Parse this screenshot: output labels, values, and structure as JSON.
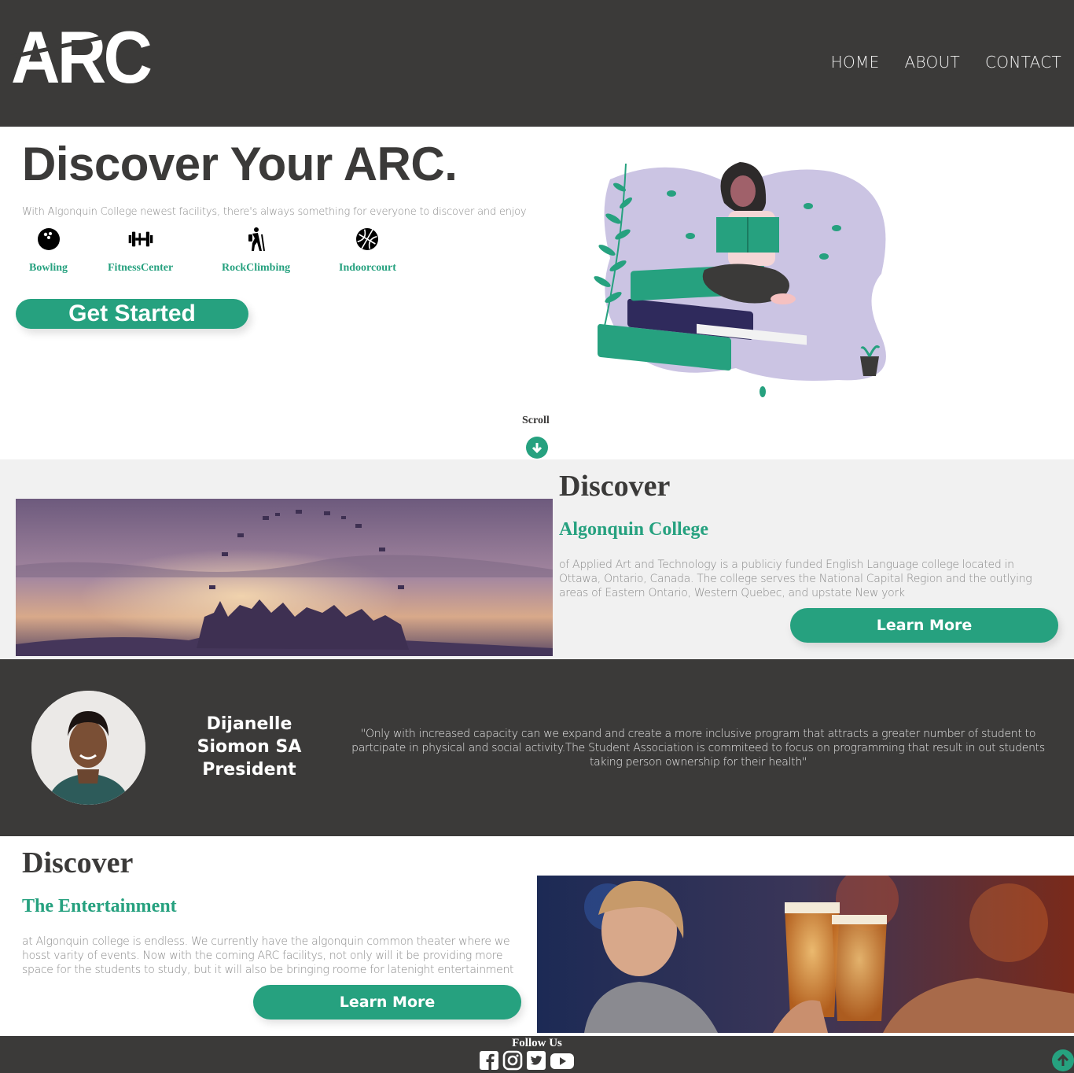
{
  "header": {
    "logo": "ARC",
    "nav": [
      "HOME",
      "ABOUT",
      "CONTACT"
    ]
  },
  "hero": {
    "title": "Discover Your ARC.",
    "subtitle": "With Algonquin College newest facilitys, there's always something for everyone to discover and enjoy",
    "facilities": [
      {
        "label": "Bowling",
        "icon": "bowling-ball-icon"
      },
      {
        "label": "FitnessCenter",
        "icon": "dumbbell-icon"
      },
      {
        "label": "RockClimbing",
        "icon": "hiker-icon"
      },
      {
        "label": "Indoorcourt",
        "icon": "basketball-icon"
      }
    ],
    "cta": "Get Started",
    "scroll": "Scroll"
  },
  "college": {
    "heading": "Discover",
    "subheading": "Algonquin College",
    "text": "of Applied Art and Technology is a publiciy funded English Language college located in Ottawa, Ontario, Canada. The college serves the National Capital Region and the outlying areas of Eastern Ontario, Western Quebec, and upstate New york",
    "button": "Learn More"
  },
  "president": {
    "name": "Dijanelle Siomon SA President",
    "quote": "\"Only with increased capacity can we expand and create a more inclusive program that attracts a greater number of student to partcipate in physical and social activity.The Student Association is commiteed to focus on programming that result in out students taking person ownership for their health\""
  },
  "entertainment": {
    "heading": "Discover",
    "subheading": "The Entertainment",
    "text": "at Algonquin college is endless. We currently have the algonquin common theater where we hosst varity of events. Now with the coming ARC facilitys, not only will it be providing more space for the students to study, but it will also be bringing roome for latenight entertainment",
    "button": "Learn More"
  },
  "footer": {
    "follow": "Follow Us",
    "socials": [
      "facebook-icon",
      "instagram-icon",
      "twitter-icon",
      "youtube-icon"
    ]
  },
  "colors": {
    "dark": "#3b3a39",
    "accent": "#26a17f",
    "light": "#f1f1f1"
  }
}
